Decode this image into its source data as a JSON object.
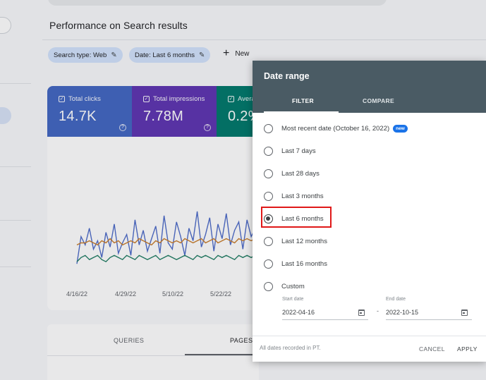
{
  "performance": {
    "title": "Performance on Search results",
    "filters": [
      {
        "label": "Search type: Web"
      },
      {
        "label": "Date: Last 6 months"
      }
    ],
    "new_label": "New"
  },
  "metrics": [
    {
      "label": "Total clicks",
      "value": "14.7K",
      "color": "#4267c2"
    },
    {
      "label": "Total impressions",
      "value": "7.78M",
      "color": "#5e35b1"
    },
    {
      "label": "Avera",
      "value": "0.2%",
      "color": "#00796b"
    }
  ],
  "chart_data": {
    "type": "line",
    "x": [
      "4/16/22",
      "4/29/22",
      "5/10/22",
      "5/22/22"
    ],
    "series": [
      {
        "color": "#4f6dc9",
        "values": [
          5,
          18,
          14,
          22,
          12,
          16,
          8,
          20,
          13,
          24,
          10,
          15,
          19,
          9,
          26,
          14,
          21,
          11,
          17,
          23,
          10,
          28,
          15,
          12,
          25,
          18,
          9,
          22,
          16,
          30,
          13,
          19,
          27,
          11,
          24,
          17,
          29,
          14,
          21,
          25,
          12,
          26,
          18,
          22
        ]
      },
      {
        "color": "#c87d2c",
        "values": [
          14,
          15,
          15,
          16,
          15,
          14,
          16,
          15,
          17,
          15,
          16,
          14,
          15,
          16,
          15,
          17,
          16,
          15,
          14,
          16,
          15,
          17,
          16,
          15,
          16,
          15,
          17,
          16,
          15,
          16,
          17,
          15,
          16,
          17,
          15,
          16,
          17,
          16,
          15,
          17,
          16,
          17,
          16,
          17
        ]
      },
      {
        "color": "#1f7d63",
        "values": [
          6,
          8,
          9,
          7,
          8,
          9,
          7,
          6,
          8,
          9,
          8,
          7,
          9,
          8,
          7,
          9,
          8,
          7,
          8,
          9,
          7,
          8,
          9,
          8,
          7,
          8,
          9,
          8,
          7,
          9,
          8,
          9,
          8,
          7,
          9,
          8,
          9,
          8,
          7,
          9,
          8,
          9,
          8,
          9
        ]
      }
    ],
    "grid": false
  },
  "bottom_tabs": {
    "queries": "QUERIES",
    "pages": "PAGES"
  },
  "dialog": {
    "title": "Date range",
    "tabs": {
      "filter": "FILTER",
      "compare": "COMPARE"
    },
    "options": [
      {
        "label": "Most recent date (October 16, 2022)",
        "badge": "new",
        "selected": false
      },
      {
        "label": "Last 7 days",
        "selected": false
      },
      {
        "label": "Last 28 days",
        "selected": false
      },
      {
        "label": "Last 3 months",
        "selected": false
      },
      {
        "label": "Last 6 months",
        "selected": true
      },
      {
        "label": "Last 12 months",
        "selected": false
      },
      {
        "label": "Last 16 months",
        "selected": false
      },
      {
        "label": "Custom",
        "selected": false
      }
    ],
    "start_date": {
      "label": "Start date",
      "value": "2022-04-16"
    },
    "end_date": {
      "label": "End date",
      "value": "2022-10-15"
    },
    "range_separator": "-",
    "footer_note": "All dates recorded in PT.",
    "cancel_label": "CANCEL",
    "apply_label": "APPLY"
  },
  "icons": {
    "edit": "pencil-icon",
    "help": "help-circle-icon",
    "calendar": "calendar-icon",
    "checkbox": "checkbox-icon",
    "chevron": "chevron-left-icon"
  }
}
